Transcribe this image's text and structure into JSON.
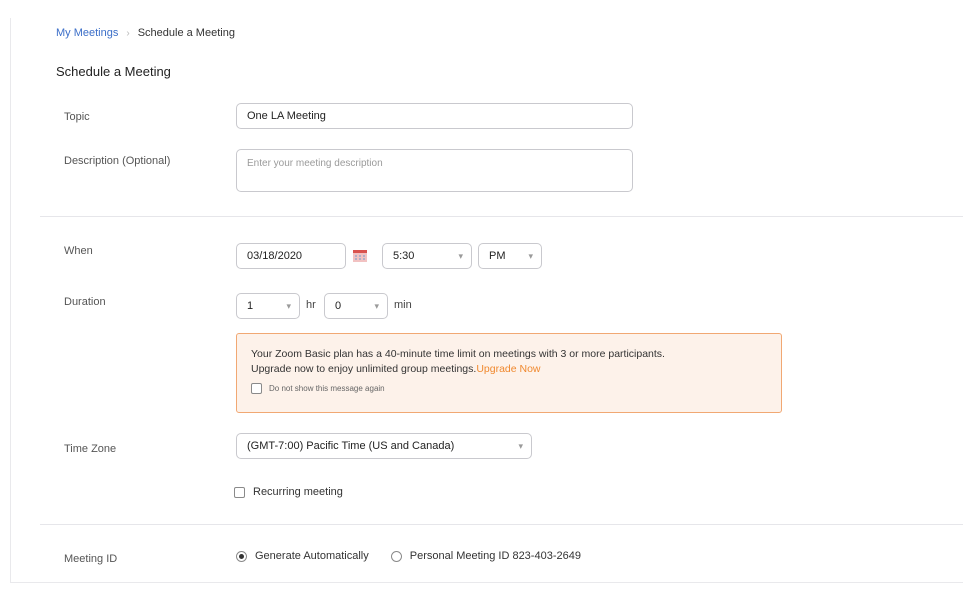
{
  "breadcrumb": {
    "parent": "My Meetings",
    "separator": "›",
    "current": "Schedule a Meeting"
  },
  "page_title": "Schedule a Meeting",
  "topic": {
    "label": "Topic",
    "value": "One LA Meeting"
  },
  "description": {
    "label": "Description (Optional)",
    "placeholder": "Enter your meeting description"
  },
  "when": {
    "label": "When",
    "date": "03/18/2020",
    "time": "5:30",
    "ampm": "PM"
  },
  "duration": {
    "label": "Duration",
    "hours": "1",
    "hours_unit": "hr",
    "minutes": "0",
    "minutes_unit": "min"
  },
  "notice": {
    "line1": "Your Zoom Basic plan has a 40-minute time limit on meetings with 3 or more participants.",
    "line2": "Upgrade now to enjoy unlimited group meetings.",
    "link": "Upgrade Now",
    "checkbox_label": "Do not show this message again",
    "border_color": "#f1a873",
    "background_color": "#fdf2ea"
  },
  "time_zone": {
    "label": "Time Zone",
    "value": "(GMT-7:00) Pacific Time (US and Canada)"
  },
  "recurring": {
    "label": "Recurring meeting",
    "checked": false
  },
  "meeting_id": {
    "label": "Meeting ID",
    "option_auto": "Generate Automatically",
    "option_personal": "Personal Meeting ID 823-403-2649",
    "selected": "auto"
  },
  "icons": {
    "calendar": "calendar-icon",
    "chevron": "chevron-down-icon"
  },
  "colors": {
    "link": "#3b6ec8",
    "accent_orange": "#f0892f"
  }
}
